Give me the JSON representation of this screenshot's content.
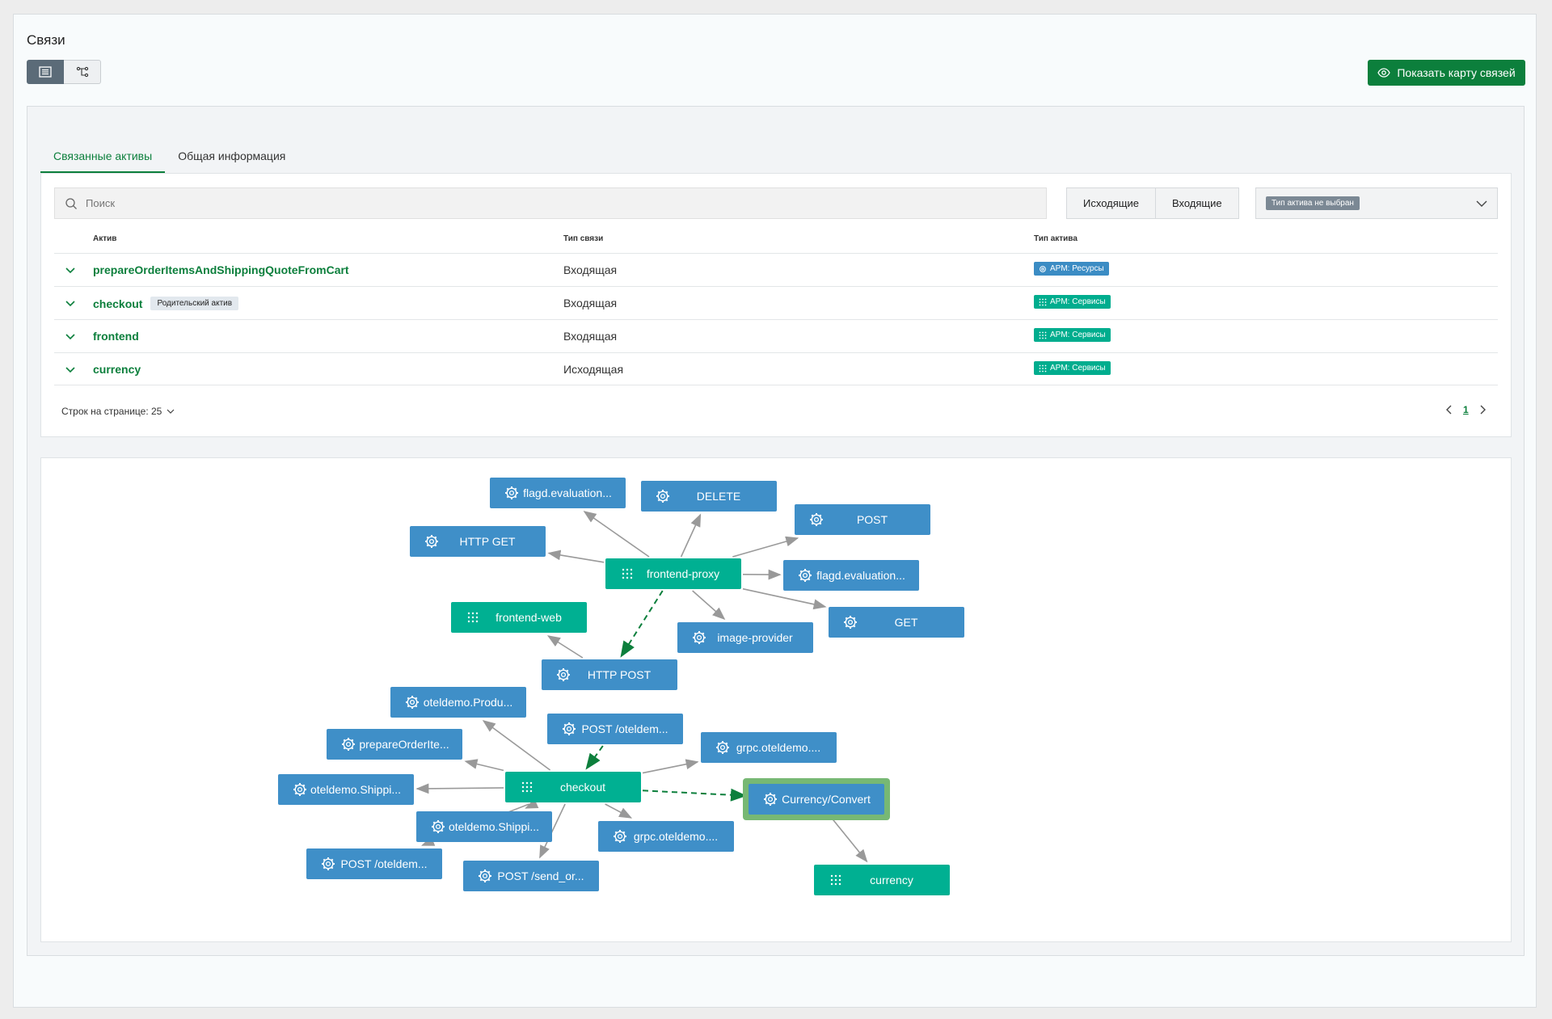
{
  "page": {
    "title": "Связи"
  },
  "toolbar": {
    "map_button_label": "Показать карту связей"
  },
  "tabs": [
    {
      "label": "Связанные активы",
      "active": true
    },
    {
      "label": "Общая информация",
      "active": false
    }
  ],
  "search": {
    "placeholder": "Поиск",
    "value": ""
  },
  "direction": {
    "outgoing": "Исходящие",
    "incoming": "Входящие"
  },
  "type_filter": {
    "value": "Тип актива не выбран"
  },
  "table": {
    "headers": {
      "asset": "Актив",
      "relation": "Тип связи",
      "asset_type": "Тип актива"
    },
    "rows": [
      {
        "asset": "prepareOrderItemsAndShippingQuoteFromCart",
        "badge": "",
        "relation": "Входящая",
        "type": "APM: Ресурсы",
        "type_color": "#3b8cc4",
        "type_icon": "gear-icon"
      },
      {
        "asset": "checkout",
        "badge": "Родительский актив",
        "relation": "Входящая",
        "type": "APM: Сервисы",
        "type_color": "#00ad8e",
        "type_icon": "grid-icon"
      },
      {
        "asset": "frontend",
        "badge": "",
        "relation": "Входящая",
        "type": "APM: Сервисы",
        "type_color": "#00ad8e",
        "type_icon": "grid-icon"
      },
      {
        "asset": "currency",
        "badge": "",
        "relation": "Исходящая",
        "type": "APM: Сервисы",
        "type_color": "#00ad8e",
        "type_icon": "grid-icon"
      }
    ]
  },
  "pagination": {
    "rows_per_page_label": "Строк на странице: 25",
    "current_page": "1"
  },
  "colors": {
    "resource": "#3f8fc8",
    "service": "#00b092",
    "accent": "#0c7f3c",
    "highlight": "#77b874"
  },
  "graph": {
    "nodes": [
      {
        "id": "flagd1",
        "label": "flagd.evaluation...",
        "kind": "resource"
      },
      {
        "id": "delete",
        "label": "DELETE",
        "kind": "resource"
      },
      {
        "id": "post",
        "label": "POST",
        "kind": "resource"
      },
      {
        "id": "httpget",
        "label": "HTTP GET",
        "kind": "resource"
      },
      {
        "id": "fproxy",
        "label": "frontend-proxy",
        "kind": "service"
      },
      {
        "id": "flagd2",
        "label": "flagd.evaluation...",
        "kind": "resource"
      },
      {
        "id": "fweb",
        "label": "frontend-web",
        "kind": "service"
      },
      {
        "id": "imgprov",
        "label": "image-provider",
        "kind": "resource"
      },
      {
        "id": "get",
        "label": "GET",
        "kind": "resource"
      },
      {
        "id": "httppost",
        "label": "HTTP POST",
        "kind": "resource"
      },
      {
        "id": "produ",
        "label": "oteldemo.Produ...",
        "kind": "resource"
      },
      {
        "id": "postotel1",
        "label": "POST /oteldem...",
        "kind": "resource"
      },
      {
        "id": "prepare",
        "label": "prepareOrderIte...",
        "kind": "resource"
      },
      {
        "id": "grpc1",
        "label": "grpc.oteldemo....",
        "kind": "resource"
      },
      {
        "id": "shippi1",
        "label": "oteldemo.Shippi...",
        "kind": "resource"
      },
      {
        "id": "checkout",
        "label": "checkout",
        "kind": "service"
      },
      {
        "id": "currconv",
        "label": "Currency/Convert",
        "kind": "resource",
        "highlight": true
      },
      {
        "id": "shippi2",
        "label": "oteldemo.Shippi...",
        "kind": "resource"
      },
      {
        "id": "grpc2",
        "label": "grpc.oteldemo....",
        "kind": "resource"
      },
      {
        "id": "postotel2",
        "label": "POST /oteldem...",
        "kind": "resource"
      },
      {
        "id": "postsend",
        "label": "POST /send_or...",
        "kind": "resource"
      },
      {
        "id": "currency",
        "label": "currency",
        "kind": "service"
      }
    ],
    "edges": [
      {
        "from": "fproxy",
        "to": "flagd1",
        "style": "solid"
      },
      {
        "from": "fproxy",
        "to": "delete",
        "style": "solid"
      },
      {
        "from": "fproxy",
        "to": "post",
        "style": "solid"
      },
      {
        "from": "fproxy",
        "to": "httpget",
        "style": "solid"
      },
      {
        "from": "fproxy",
        "to": "flagd2",
        "style": "solid"
      },
      {
        "from": "fproxy",
        "to": "get",
        "style": "solid"
      },
      {
        "from": "fproxy",
        "to": "imgprov",
        "style": "solid"
      },
      {
        "from": "fproxy",
        "to": "httppost",
        "style": "dashed"
      },
      {
        "from": "httppost",
        "to": "fweb",
        "style": "solid"
      },
      {
        "from": "postotel1",
        "to": "checkout",
        "style": "dashed"
      },
      {
        "from": "checkout",
        "to": "produ",
        "style": "solid"
      },
      {
        "from": "checkout",
        "to": "prepare",
        "style": "solid"
      },
      {
        "from": "checkout",
        "to": "grpc1",
        "style": "solid"
      },
      {
        "from": "checkout",
        "to": "shippi1",
        "style": "solid"
      },
      {
        "from": "checkout",
        "to": "currconv",
        "style": "dashed"
      },
      {
        "from": "checkout",
        "to": "shippi2",
        "style": "solid"
      },
      {
        "from": "checkout",
        "to": "grpc2",
        "style": "solid"
      },
      {
        "from": "checkout",
        "to": "postotel2",
        "style": "solid"
      },
      {
        "from": "checkout",
        "to": "postsend",
        "style": "solid"
      },
      {
        "from": "currconv",
        "to": "currency",
        "style": "solid"
      }
    ]
  }
}
